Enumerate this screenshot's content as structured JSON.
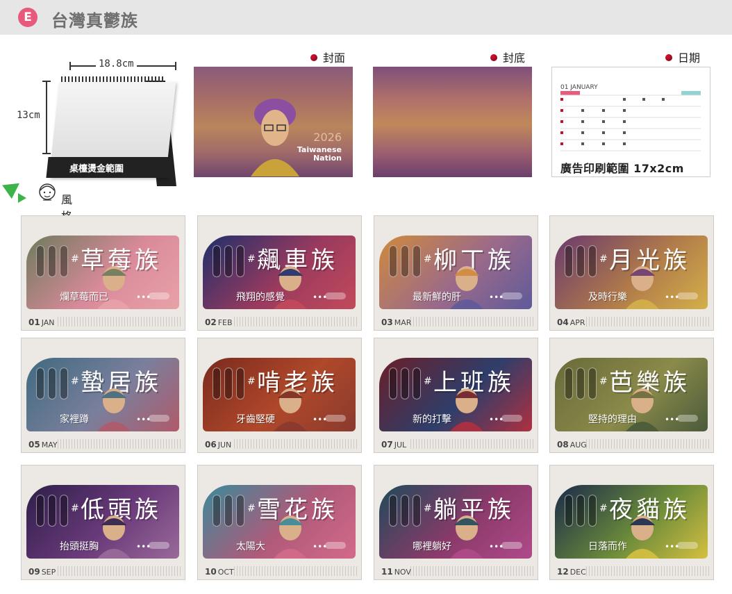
{
  "header": {
    "badge": "E",
    "title": "台灣真鬱族"
  },
  "desk_calendar": {
    "width_label": "18.8cm",
    "height_label": "13cm",
    "base_label": "桌檯燙金範圍"
  },
  "style_section": {
    "label": "風格圖案"
  },
  "previews": {
    "cover_label": "封面",
    "back_label": "封底",
    "date_label": "日期",
    "cover_year": "2026",
    "cover_name": "Taiwanese\nNation",
    "date_month": "01 JANUARY",
    "date_footer": "廣告印刷範圍 17x2cm"
  },
  "colors": {
    "accent_pink": "#e85a7b",
    "dot_red": "#c8102e",
    "arrow_green": "#3cb44a",
    "card_bg": "#ece8e3"
  },
  "months": [
    {
      "num": "01",
      "abbr": "JAN",
      "title": "草莓族",
      "sub": "爛草莓而已",
      "c1": "#6e7a5c",
      "c2": "#d98a9a",
      "c3": "#e9a2a8"
    },
    {
      "num": "02",
      "abbr": "FEB",
      "title": "飆車族",
      "sub": "飛翔的感覺",
      "c1": "#1e2f6b",
      "c2": "#9a3a5e",
      "c3": "#c24a5b"
    },
    {
      "num": "03",
      "abbr": "MAR",
      "title": "柳丁族",
      "sub": "最新鮮的肝",
      "c1": "#d08a3c",
      "c2": "#9a6a8a",
      "c3": "#5f5a9a"
    },
    {
      "num": "04",
      "abbr": "APR",
      "title": "月光族",
      "sub": "及時行樂",
      "c1": "#6a3a6e",
      "c2": "#b07a4a",
      "c3": "#d4b04a"
    },
    {
      "num": "05",
      "abbr": "MAY",
      "title": "蟄居族",
      "sub": "家裡蹲",
      "c1": "#3f6a80",
      "c2": "#7a7f9c",
      "c3": "#b05a6a"
    },
    {
      "num": "06",
      "abbr": "JUN",
      "title": "啃老族",
      "sub": "牙齒堅硬",
      "c1": "#7a2a1e",
      "c2": "#b0482a",
      "c3": "#8a3a2e"
    },
    {
      "num": "07",
      "abbr": "JUL",
      "title": "上班族",
      "sub": "新的打擊",
      "c1": "#6a1f2a",
      "c2": "#2e3e6a",
      "c3": "#b03040"
    },
    {
      "num": "08",
      "abbr": "AUG",
      "title": "芭樂族",
      "sub": "堅持的理由",
      "c1": "#6a6a3a",
      "c2": "#8a8a4a",
      "c3": "#4a5a3a"
    },
    {
      "num": "09",
      "abbr": "SEP",
      "title": "低頭族",
      "sub": "抬頭挺胸",
      "c1": "#2e1f4a",
      "c2": "#6a3a7a",
      "c3": "#9a6a9a"
    },
    {
      "num": "10",
      "abbr": "OCT",
      "title": "雪花族",
      "sub": "太陽大",
      "c1": "#3a8a9a",
      "c2": "#b05a7a",
      "c3": "#d46a8a"
    },
    {
      "num": "11",
      "abbr": "NOV",
      "title": "躺平族",
      "sub": "哪裡躺好",
      "c1": "#1f4a5a",
      "c2": "#8a3a6a",
      "c3": "#b04a8a"
    },
    {
      "num": "12",
      "abbr": "DEC",
      "title": "夜貓族",
      "sub": "日落而作",
      "c1": "#1a2a4a",
      "c2": "#6a8a3a",
      "c3": "#d4c040"
    }
  ]
}
